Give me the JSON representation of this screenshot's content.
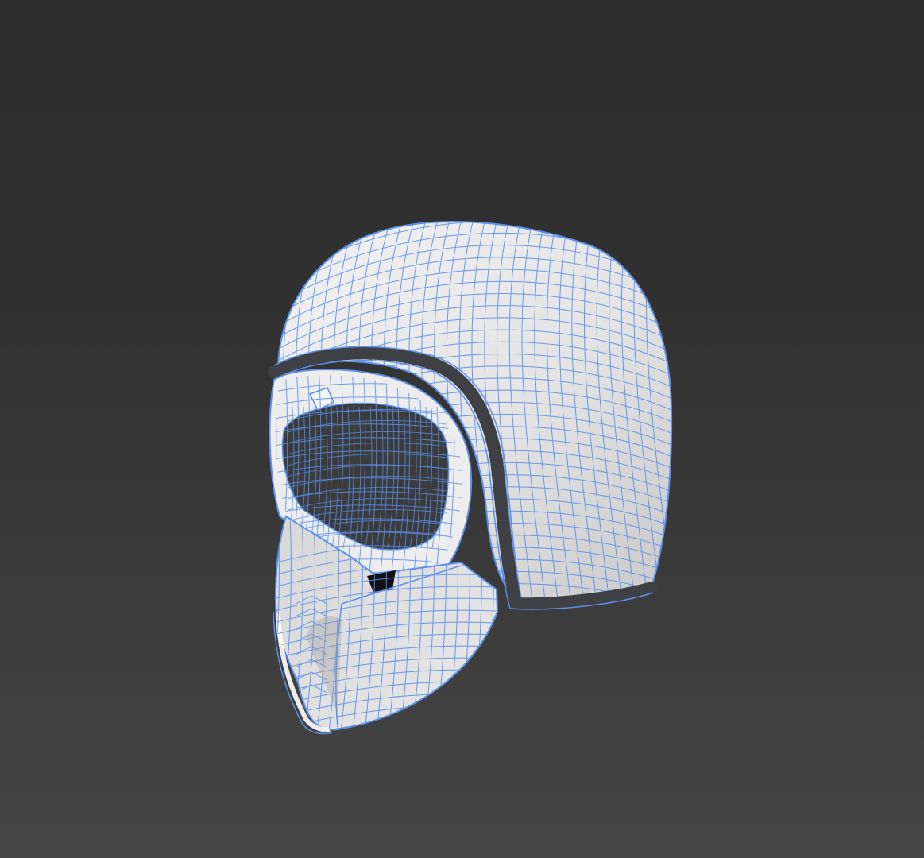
{
  "viewport": {
    "kind": "3d-perspective-viewport",
    "display_mode": "shaded-with-wireframe",
    "background_colors": {
      "top": "#2b2b2b",
      "bottom": "#464646"
    }
  },
  "model": {
    "object": "motorcycle-helmet-with-goggles-and-face-mask",
    "surface_color": "#e6e6e6",
    "wire_color": "#5b8fe8",
    "trim_color": "#3f4044",
    "opening_color": "#3a3a3a"
  }
}
